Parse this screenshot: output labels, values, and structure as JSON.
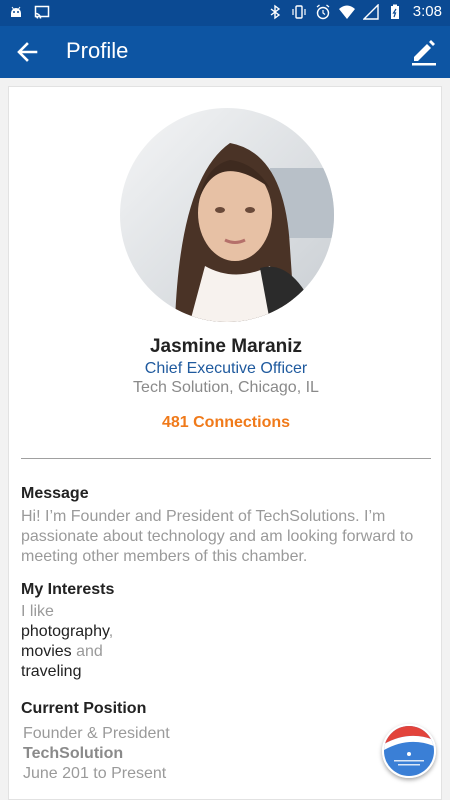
{
  "status_bar": {
    "time": "3:08",
    "left_icons": [
      "android-icon",
      "cast-icon"
    ],
    "right_icons": [
      "bluetooth-icon",
      "vibrate-icon",
      "alarm-icon",
      "wifi-icon",
      "signal-icon",
      "battery-icon"
    ]
  },
  "app_bar": {
    "title": "Profile",
    "back_icon": "arrow-back-icon",
    "edit_icon": "edit-pencil-icon",
    "color": "#0d55a3"
  },
  "profile": {
    "name": "Jasmine Maraniz",
    "job_title": "Chief Executive Officer",
    "company_location": "Tech Solution, Chicago, IL",
    "connections": "481 Connections"
  },
  "message": {
    "heading": "Message",
    "text": "Hi! I’m Founder and President of TechSolutions. I’m passionate about technology and am looking forward to meeting other members of this chamber."
  },
  "interests": {
    "heading": "My Interests",
    "intro": "I like",
    "item1": "photography",
    "sep1": ",",
    "item2": "movies",
    "and": " and",
    "item3": "traveling"
  },
  "current_position": {
    "heading": "Current Position",
    "role": "Founder & President",
    "company": "TechSolution",
    "dates": "June 201 to Present"
  },
  "colors": {
    "status_bar": "#0b4a93",
    "accent_orange": "#f07a1a",
    "job_title_blue": "#1f5a9e"
  }
}
